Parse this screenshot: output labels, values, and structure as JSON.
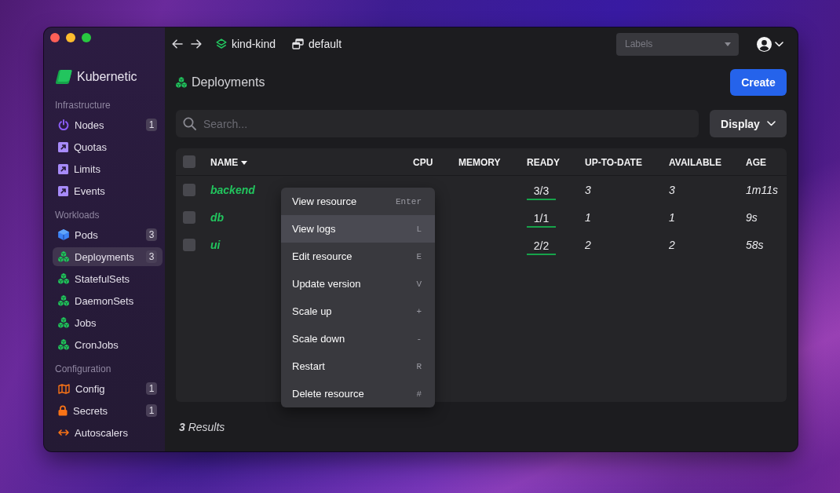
{
  "app": {
    "name": "Kubernetic"
  },
  "sidebar": {
    "sections": [
      {
        "title": "Infrastructure",
        "items": [
          {
            "label": "Nodes",
            "kind": "node",
            "count": "1",
            "selected": false
          },
          {
            "label": "Quotas",
            "kind": "quota",
            "selected": false
          },
          {
            "label": "Limits",
            "kind": "limit",
            "selected": false
          },
          {
            "label": "Events",
            "kind": "event",
            "selected": false
          }
        ]
      },
      {
        "title": "Workloads",
        "items": [
          {
            "label": "Pods",
            "kind": "pod",
            "count": "3",
            "selected": false
          },
          {
            "label": "Deployments",
            "kind": "deployment",
            "count": "3",
            "selected": true
          },
          {
            "label": "StatefulSets",
            "kind": "statefulset",
            "selected": false
          },
          {
            "label": "DaemonSets",
            "kind": "daemonset",
            "selected": false
          },
          {
            "label": "Jobs",
            "kind": "job",
            "selected": false
          },
          {
            "label": "CronJobs",
            "kind": "cronjob",
            "selected": false
          }
        ]
      },
      {
        "title": "Configuration",
        "items": [
          {
            "label": "Config",
            "kind": "configmap",
            "count": "1",
            "selected": false
          },
          {
            "label": "Secrets",
            "kind": "secret",
            "count": "1",
            "selected": false
          },
          {
            "label": "Autoscalers",
            "kind": "autoscaler",
            "selected": false
          }
        ]
      }
    ]
  },
  "topbar": {
    "context": "kind-kind",
    "namespace": "default",
    "labels_filter": {
      "placeholder": "Labels"
    }
  },
  "page": {
    "title": "Deployments",
    "kind": "deployment",
    "create_button": "Create"
  },
  "search": {
    "placeholder": "Search..."
  },
  "display_button": "Display",
  "table": {
    "select_all": {
      "checked": false
    },
    "columns": [
      {
        "label": "NAME",
        "sorted": true
      },
      {
        "label": "CPU",
        "sorted": false
      },
      {
        "label": "MEMORY",
        "sorted": false
      },
      {
        "label": "READY",
        "sorted": false
      },
      {
        "label": "UP-TO-DATE",
        "sorted": false
      },
      {
        "label": "AVAILABLE",
        "sorted": false
      },
      {
        "label": "AGE",
        "sorted": false
      }
    ],
    "rows": [
      {
        "checked": false,
        "name": "backend",
        "ready": "3/3",
        "up_to_date": "3",
        "available": "3",
        "age": "1m11s"
      },
      {
        "checked": false,
        "name": "db",
        "ready": "1/1",
        "up_to_date": "1",
        "available": "1",
        "age": "9s"
      },
      {
        "checked": false,
        "name": "ui",
        "ready": "2/2",
        "up_to_date": "2",
        "available": "2",
        "age": "58s"
      }
    ]
  },
  "context_menu": {
    "items": [
      {
        "label": "View resource",
        "shortcut": "Enter",
        "selected": false
      },
      {
        "label": "View logs",
        "shortcut": "L",
        "selected": true
      },
      {
        "label": "Edit resource",
        "shortcut": "E",
        "selected": false
      },
      {
        "label": "Update version",
        "shortcut": "V",
        "selected": false
      },
      {
        "label": "Scale up",
        "shortcut": "+",
        "selected": false
      },
      {
        "label": "Scale down",
        "shortcut": "-",
        "selected": false
      },
      {
        "label": "Restart",
        "shortcut": "R",
        "selected": false
      },
      {
        "label": "Delete resource",
        "shortcut": "#",
        "selected": false
      }
    ]
  },
  "footer": {
    "results": "**3** Results"
  }
}
